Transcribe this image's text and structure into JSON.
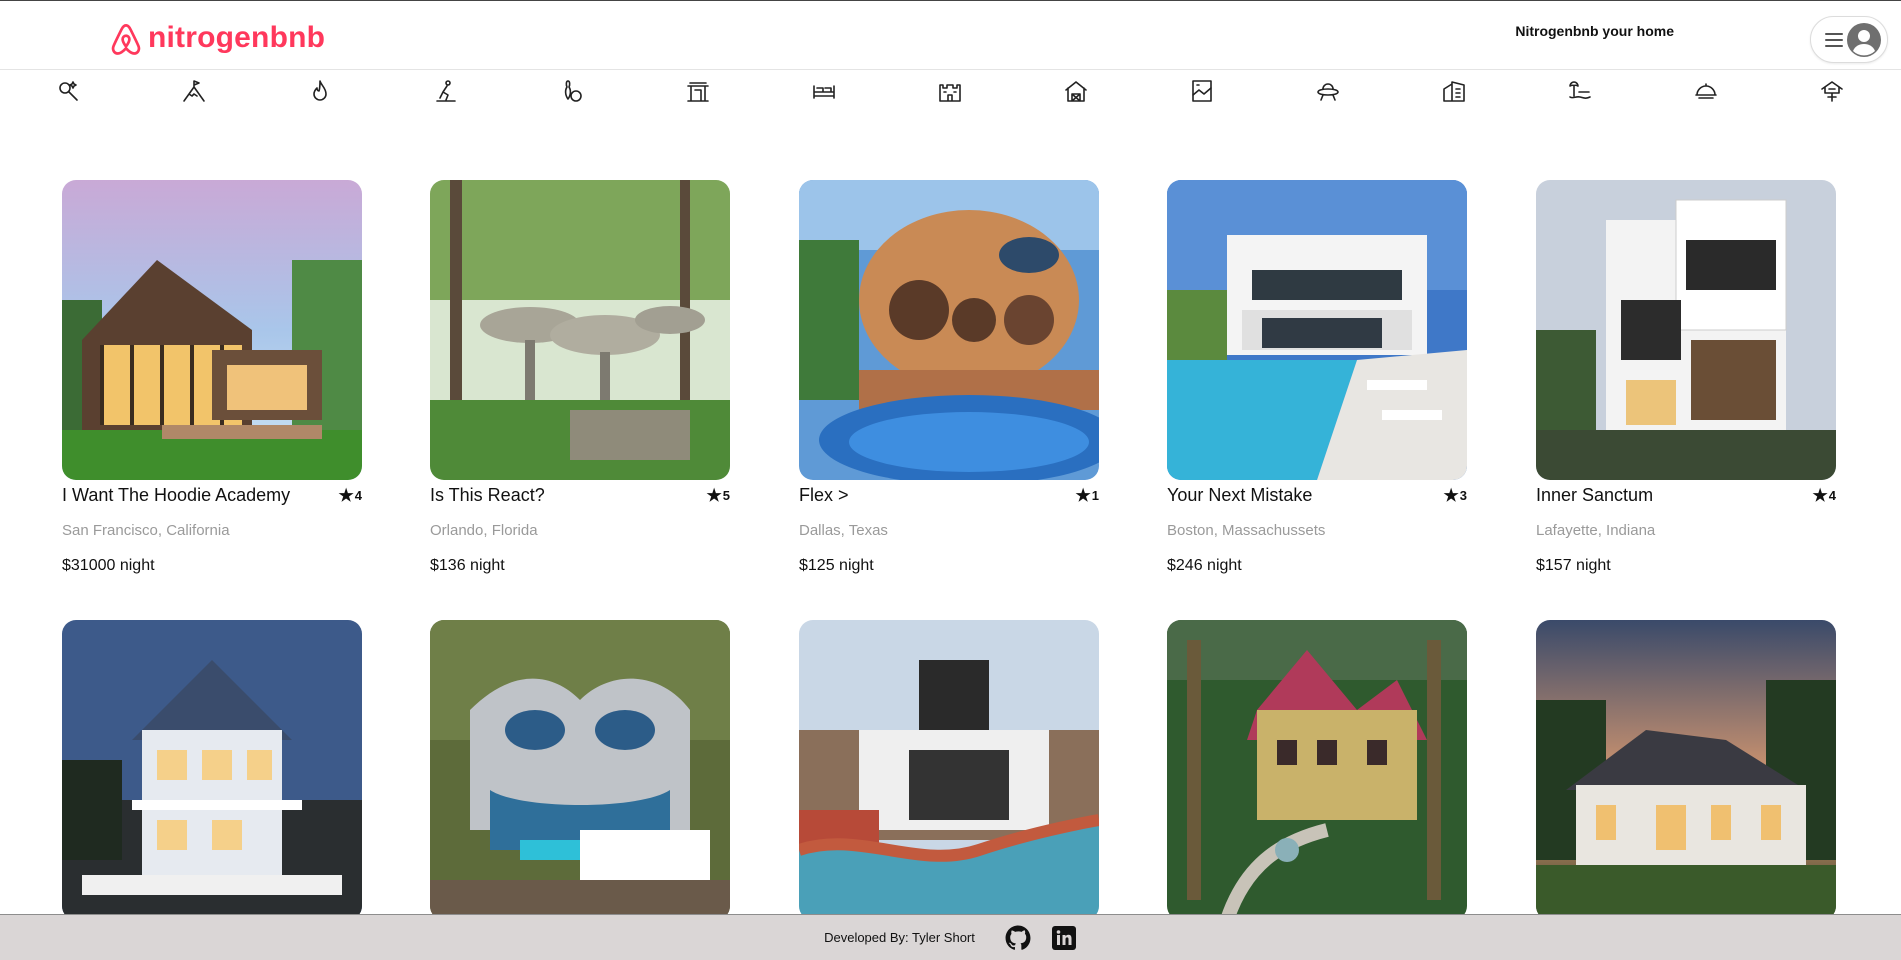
{
  "header": {
    "brand": "nitrogenbnb",
    "host_link": "Nitrogenbnb your home",
    "brand_color": "#ff385c"
  },
  "categories": [
    {
      "icon": "magic-wand-icon"
    },
    {
      "icon": "mountain-flag-icon"
    },
    {
      "icon": "flame-icon"
    },
    {
      "icon": "skier-icon"
    },
    {
      "icon": "bowling-icon"
    },
    {
      "icon": "pagoda-icon"
    },
    {
      "icon": "beds-icon"
    },
    {
      "icon": "castle-icon"
    },
    {
      "icon": "barn-icon"
    },
    {
      "icon": "map-frame-icon"
    },
    {
      "icon": "ufo-icon"
    },
    {
      "icon": "building-icon"
    },
    {
      "icon": "beach-icon"
    },
    {
      "icon": "cloche-icon"
    },
    {
      "icon": "treehouse-icon"
    }
  ],
  "listings": [
    {
      "title": "I Want The Hoodie Academy",
      "rating": "4",
      "location": "San Francisco, California",
      "price": "$31000 night"
    },
    {
      "title": "Is This React?",
      "rating": "5",
      "location": "Orlando, Florida",
      "price": "$136 night"
    },
    {
      "title": "Flex >",
      "rating": "1",
      "location": "Dallas, Texas",
      "price": "$125 night"
    },
    {
      "title": "Your Next Mistake",
      "rating": "3",
      "location": "Boston, Massachussets",
      "price": "$246 night"
    },
    {
      "title": "Inner Sanctum",
      "rating": "4",
      "location": "Lafayette, Indiana",
      "price": "$157 night"
    }
  ],
  "listings_row2_count": 5,
  "footer": {
    "developer": "Developed By: Tyler Short",
    "icons": [
      "github-icon",
      "linkedin-icon"
    ]
  }
}
